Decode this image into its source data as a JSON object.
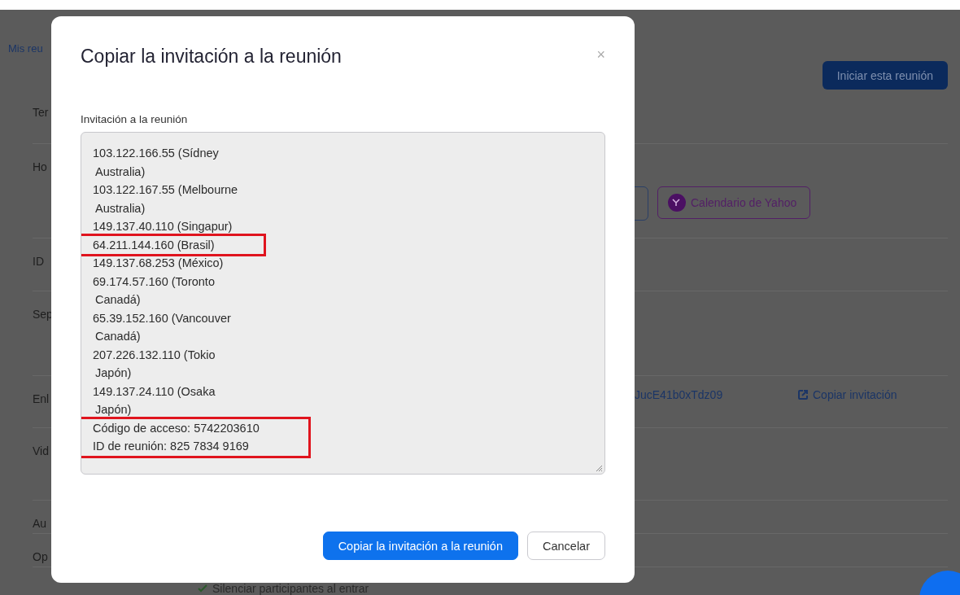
{
  "page": {
    "breadcrumb": "Mis reu",
    "start_button": "Iniciar esta reunión",
    "rows": [
      {
        "label": "Ter"
      },
      {
        "label": "Ho",
        "kind": "calendars",
        "buttons": [
          {
            "label": "Calendario de Yahoo"
          }
        ]
      },
      {
        "label": "ID"
      },
      {
        "label": "Sep"
      },
      {
        "label": "Enl",
        "kind": "link",
        "value": "JucE41b0xTdz09",
        "action": "Copiar invitación"
      },
      {
        "label": "Vid"
      },
      {
        "label": "Au"
      },
      {
        "label": "Op"
      }
    ],
    "option": {
      "label": "Silenciar participantes al entrar",
      "checked": true
    }
  },
  "dialog": {
    "title": "Copiar la invitación a la reunión",
    "close": "×",
    "field_label": "Invitación a la reunión",
    "blocks": [
      {
        "highlighted": false,
        "lines": [
          {
            "text": "103.122.166.55 (Sídney",
            "kind": "line"
          },
          {
            "text": "Australia)",
            "kind": "wrap"
          },
          {
            "text": "103.122.167.55 (Melbourne",
            "kind": "line"
          },
          {
            "text": "Australia)",
            "kind": "wrap"
          },
          {
            "text": "149.137.40.110 (Singapur)",
            "kind": "line"
          }
        ]
      },
      {
        "highlighted": true,
        "lines": [
          {
            "text": "64.211.144.160 (Brasil)",
            "kind": "line"
          }
        ]
      },
      {
        "highlighted": false,
        "lines": [
          {
            "text": "149.137.68.253 (México)",
            "kind": "line"
          },
          {
            "text": "69.174.57.160 (Toronto",
            "kind": "line"
          },
          {
            "text": "Canadá)",
            "kind": "wrap"
          },
          {
            "text": "65.39.152.160 (Vancouver",
            "kind": "line"
          },
          {
            "text": "Canadá)",
            "kind": "wrap"
          },
          {
            "text": "207.226.132.110 (Tokio",
            "kind": "line"
          },
          {
            "text": "Japón)",
            "kind": "wrap"
          },
          {
            "text": "149.137.24.110 (Osaka",
            "kind": "line"
          },
          {
            "text": "Japón)",
            "kind": "wrap"
          }
        ]
      },
      {
        "highlighted": true,
        "lines": [
          {
            "text": "Código de acceso: 5742203610",
            "kind": "line"
          },
          {
            "text": "ID de reunión: 825 7834 9169",
            "kind": "line"
          }
        ]
      }
    ],
    "buttons": [
      {
        "label": "Copiar la invitación a la reunión",
        "kind": "primary"
      },
      {
        "label": "Cancelar",
        "kind": "secondary"
      }
    ]
  }
}
